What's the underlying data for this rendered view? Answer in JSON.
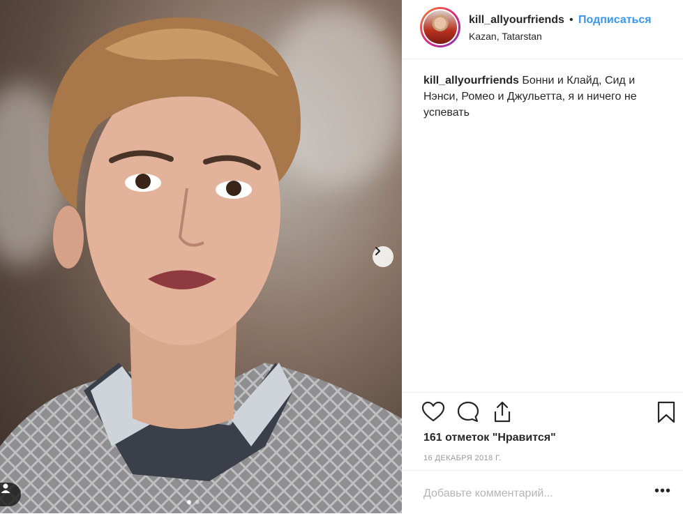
{
  "post": {
    "username": "kill_allyourfriends",
    "bullet": "•",
    "follow_label": "Подписаться",
    "location": "Kazan, Tatarstan",
    "caption_user": "kill_allyourfriends",
    "caption_text": " Бонни и Клайд, Сид и Нэнси, Ромео и Джульетта, я и ничего не успевать",
    "likes": "161 отметок \"Нравится\"",
    "date": "16 ДЕКАБРЯ 2018 Г.",
    "comment_placeholder": "Добавьте комментарий...",
    "more_label": "•••"
  },
  "colors": {
    "accent": "#3897f0",
    "text": "#262626",
    "muted": "#999999",
    "divider": "#efefef"
  },
  "icons": {
    "like": "heart-icon",
    "comment": "comment-bubble-icon",
    "share": "share-icon",
    "save": "bookmark-icon",
    "next": "chevron-right-icon",
    "tag": "user-tag-icon"
  }
}
